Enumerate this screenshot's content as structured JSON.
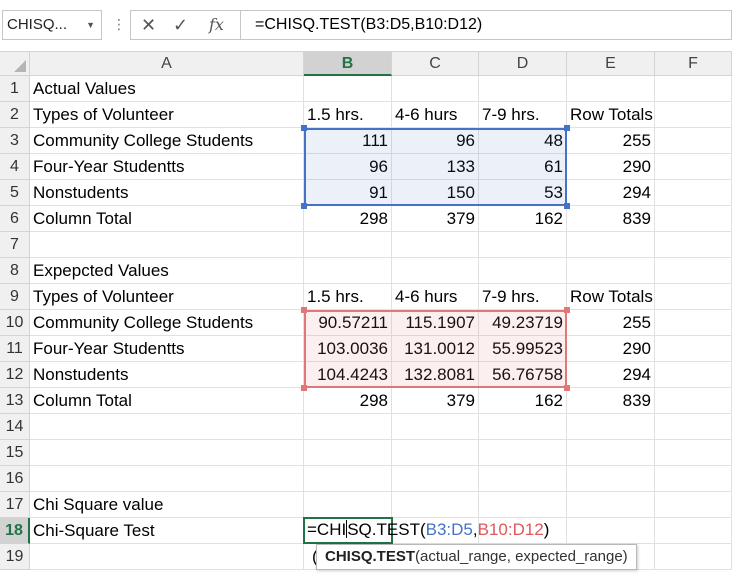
{
  "formula_bar": {
    "name_box": "CHISQ...",
    "cancel_glyph": "✕",
    "enter_glyph": "✓",
    "fx_label": "fx",
    "formula": "=CHISQ.TEST(B3:D5,B10:D12)"
  },
  "columns": [
    "A",
    "B",
    "C",
    "D",
    "E",
    "F"
  ],
  "selected_column": "B",
  "selected_row": 18,
  "rows": [
    {
      "n": "1",
      "A": "Actual Values"
    },
    {
      "n": "2",
      "A": "Types of Volunteer",
      "B": "1.5 hrs.",
      "C": "4-6 hurs",
      "D": "7-9 hrs.",
      "E": "Row Totals"
    },
    {
      "n": "3",
      "A": "Community College Students",
      "B": "111",
      "C": "96",
      "D": "48",
      "E": "255"
    },
    {
      "n": "4",
      "A": "Four-Year Studentts",
      "B": "96",
      "C": "133",
      "D": "61",
      "E": "290"
    },
    {
      "n": "5",
      "A": "Nonstudents",
      "B": "91",
      "C": "150",
      "D": "53",
      "E": "294"
    },
    {
      "n": "6",
      "A": "Column Total",
      "B": "298",
      "C": "379",
      "D": "162",
      "E": "839"
    },
    {
      "n": "7"
    },
    {
      "n": "8",
      "A": "Expepcted Values"
    },
    {
      "n": "9",
      "A": "Types of Volunteer",
      "B": "1.5 hrs.",
      "C": "4-6 hurs",
      "D": "7-9 hrs.",
      "E": "Row Totals"
    },
    {
      "n": "10",
      "A": "Community College Students",
      "B": "90.57211",
      "C": "115.1907",
      "D": "49.23719",
      "E": "255"
    },
    {
      "n": "11",
      "A": "Four-Year Studentts",
      "B": "103.0036",
      "C": "131.0012",
      "D": "55.99523",
      "E": "290"
    },
    {
      "n": "12",
      "A": "Nonstudents",
      "B": "104.4243",
      "C": "132.8081",
      "D": "56.76758",
      "E": "294"
    },
    {
      "n": "13",
      "A": "Column Total",
      "B": "298",
      "C": "379",
      "D": "162",
      "E": "839"
    },
    {
      "n": "14"
    },
    {
      "n": "15"
    },
    {
      "n": "16"
    },
    {
      "n": "17",
      "A": "Chi Square value"
    },
    {
      "n": "18",
      "A": "Chi-Square Test"
    },
    {
      "n": "19"
    }
  ],
  "edit_cell": {
    "prefix_a": "=CHI",
    "prefix_b": "SQ.TEST(",
    "ref1": "B3:D5",
    "comma": ",",
    "ref2": "B10:D12",
    "suffix": ")"
  },
  "tooltip": {
    "function_name": "CHISQ.TEST",
    "args": "(actual_range, expected_range)"
  },
  "row19_partial": "("
}
